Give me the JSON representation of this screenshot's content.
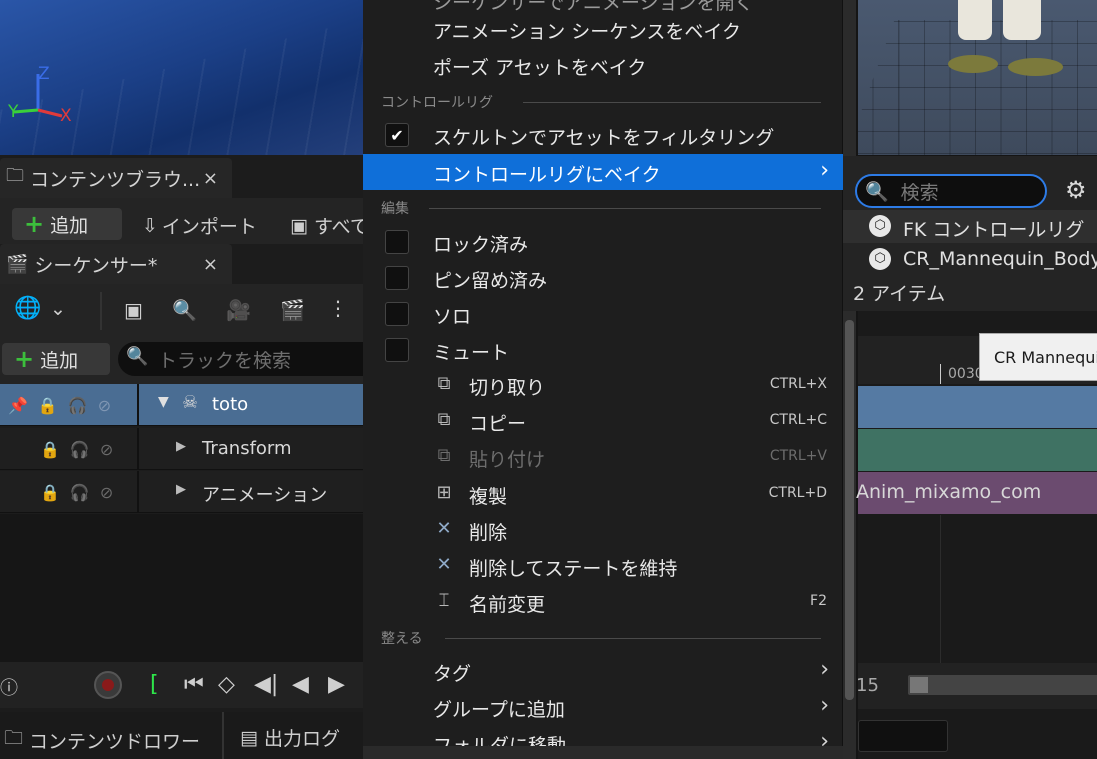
{
  "viewport": {
    "axis_z": "Z",
    "axis_y": "Y",
    "axis_x": "X"
  },
  "content_browser_tab": {
    "title": "コンテンツブラウ...",
    "close": "×"
  },
  "content_toolbar": {
    "add": "追加",
    "import": "インポート",
    "save_all": "すべて"
  },
  "sequencer_tab": {
    "title": "シーケンサー*",
    "close": "×"
  },
  "sequencer_toolbar": {
    "add": "追加",
    "search_placeholder": "トラックを検索"
  },
  "tracks": [
    {
      "label": "toto"
    },
    {
      "label": "Transform"
    },
    {
      "label": "アニメーション"
    }
  ],
  "bottom_tabs": {
    "content_drawer": "コンテンツドロワー",
    "output_log": "出力ログ"
  },
  "menu": {
    "top_partial": "シーケンサーでアニメーションを開く",
    "bake_anim_sequence": "アニメーション シーケンスをベイク",
    "bake_pose_asset": "ポーズ アセットをベイク",
    "section_control_rig": "コントロールリグ",
    "filter_assets": "スケルトンでアセットをフィルタリング",
    "bake_to_control_rig": "コントロールリグにベイク",
    "section_edit": "編集",
    "locked": "ロック済み",
    "pinned": "ピン留め済み",
    "solo": "ソロ",
    "mute": "ミュート",
    "cut": "切り取り",
    "cut_shortcut": "CTRL+X",
    "copy": "コピー",
    "copy_shortcut": "CTRL+C",
    "paste": "貼り付け",
    "paste_shortcut": "CTRL+V",
    "duplicate": "複製",
    "duplicate_shortcut": "CTRL+D",
    "delete": "削除",
    "delete_keep_state": "削除してステートを維持",
    "rename": "名前変更",
    "rename_shortcut": "F2",
    "section_organize": "整える",
    "tags": "タグ",
    "add_to_group": "グループに追加",
    "move_to_folder": "フォルダに移動"
  },
  "submenu": {
    "search_placeholder": "検索",
    "items": [
      {
        "label": "FK コントロールリグ"
      },
      {
        "label": "CR_Mannequin_Body"
      }
    ],
    "count": "2 アイテム"
  },
  "tooltip": {
    "text": "CR Mannequi"
  },
  "timeline": {
    "tick_label": "0030",
    "lane_anim_label": "Anim_mixamo_com",
    "frame_end": "15"
  },
  "colors": {
    "menu_highlight": "#0f6fd9",
    "track_toto_bg": "#4a6d93",
    "lane_blue": "#557aa3",
    "lane_teal": "#3f7263",
    "lane_purple": "#6b4b6f",
    "add_icon": "#3cbf3c"
  }
}
